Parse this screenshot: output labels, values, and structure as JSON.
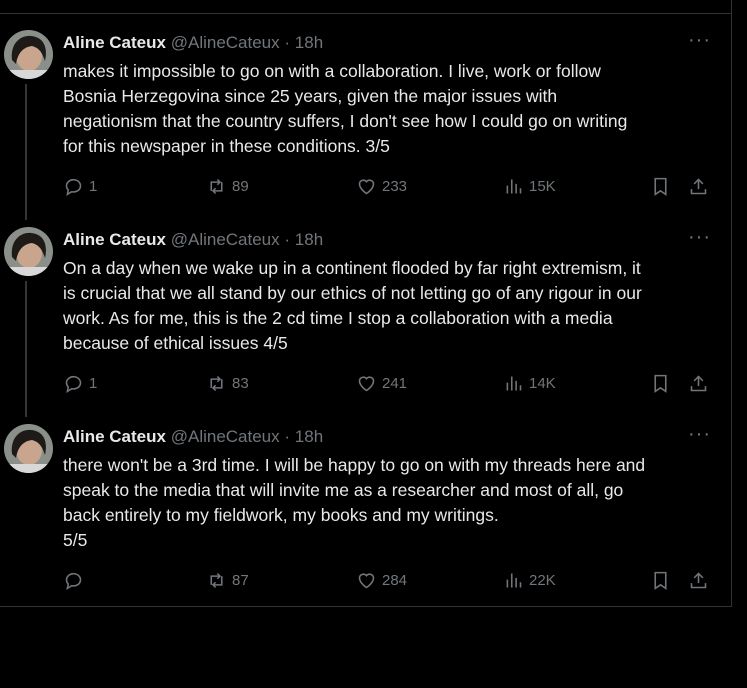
{
  "tweets": [
    {
      "name": "Aline Cateux",
      "handle": "@AlineCateux",
      "dot": "·",
      "time": "18h",
      "more": "···",
      "text": "makes it impossible to go on with a collaboration. I live, work or follow\nBosnia Herzegovina since 25 years, given the major issues with\nnegationism that the country suffers, I don't see how I could go on writing\nfor this newspaper in these conditions. 3/5",
      "replies": "1",
      "retweets": "89",
      "likes": "233",
      "views": "15K"
    },
    {
      "name": "Aline Cateux",
      "handle": "@AlineCateux",
      "dot": "·",
      "time": "18h",
      "more": "···",
      "text": "On a day when we wake up in a continent flooded by far right extremism, it\nis crucial that we all stand by our ethics of not letting go of any rigour in our\nwork. As for me, this is the 2 cd time I stop a collaboration with a media\nbecause of ethical issues 4/5",
      "replies": "1",
      "retweets": "83",
      "likes": "241",
      "views": "14K"
    },
    {
      "name": "Aline Cateux",
      "handle": "@AlineCateux",
      "dot": "·",
      "time": "18h",
      "more": "···",
      "text": "there won't be a 3rd time. I will be happy to go on with my threads here and\nspeak to the media that will invite me as a researcher and most of all, go\nback entirely to my fieldwork, my books and my writings.\n5/5",
      "replies": "",
      "retweets": "87",
      "likes": "284",
      "views": "22K"
    }
  ],
  "colors": {
    "background": "#000000",
    "text": "#e7e9ea",
    "muted": "#71767b",
    "border": "#2f3336"
  }
}
